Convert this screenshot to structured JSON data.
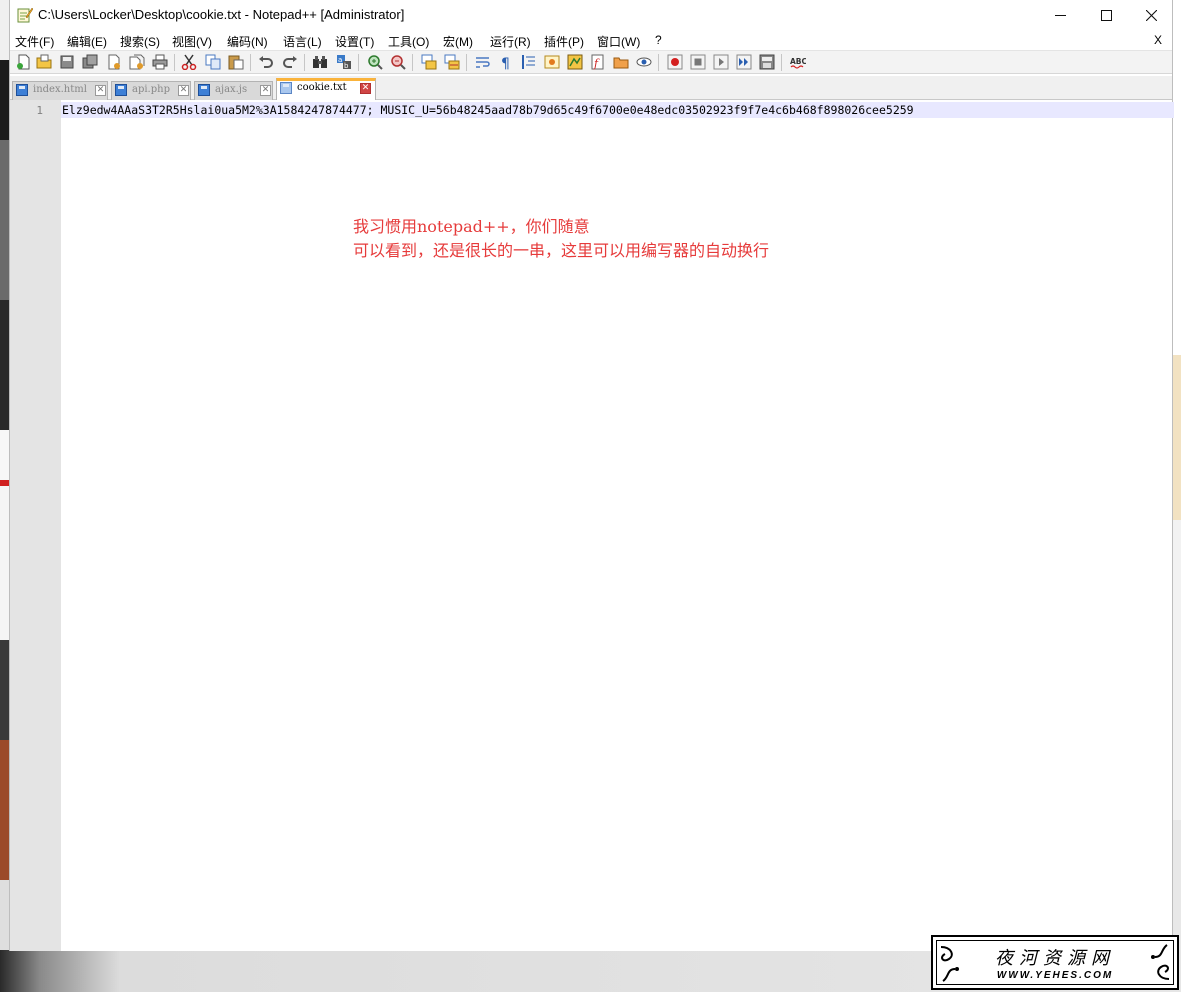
{
  "window": {
    "title": "C:\\Users\\Locker\\Desktop\\cookie.txt - Notepad++ [Administrator]",
    "controls": {
      "minimize": "minimize",
      "maximize": "maximize",
      "close": "close"
    }
  },
  "menu": {
    "items": [
      "文件(F)",
      "编辑(E)",
      "搜索(S)",
      "视图(V)",
      "编码(N)",
      "语言(L)",
      "设置(T)",
      "工具(O)",
      "宏(M)",
      "运行(R)",
      "插件(P)",
      "窗口(W)",
      "?"
    ],
    "close_label": "X"
  },
  "toolbar": {
    "buttons": [
      "new-file",
      "open-file",
      "save",
      "save-all",
      "close",
      "close-all",
      "print",
      "cut",
      "copy",
      "paste",
      "undo",
      "redo",
      "find",
      "replace",
      "zoom-in",
      "zoom-out",
      "sync-vertical",
      "sync-horizontal",
      "word-wrap",
      "show-all-chars",
      "indent-guide",
      "user-language",
      "document-map",
      "function-list",
      "folder-as-workspace",
      "monitoring",
      "record-macro",
      "stop-record",
      "play-macro",
      "run-macro-multiple",
      "save-macro",
      "spell-check"
    ]
  },
  "tabs": [
    {
      "label": "index.html",
      "active": false
    },
    {
      "label": "api.php",
      "active": false
    },
    {
      "label": "ajax.js",
      "active": false
    },
    {
      "label": "cookie.txt",
      "active": true
    }
  ],
  "editor": {
    "line_number": "1",
    "line_text": "Elz9edw4AAaS3T2R5Hslai0ua5M2%3A1584247874477; MUSIC_U=56b48245aad78b79d65c49f6700e0e48edc03502923f9f7e4c6b468f898026cee5259"
  },
  "annotations": [
    "我习惯用notepad++，你们随意",
    "可以看到，还是很长的一串，这里可以用编写器的自动换行"
  ],
  "watermark": {
    "title": "夜河资源网",
    "url": "WWW.YEHES.COM"
  }
}
